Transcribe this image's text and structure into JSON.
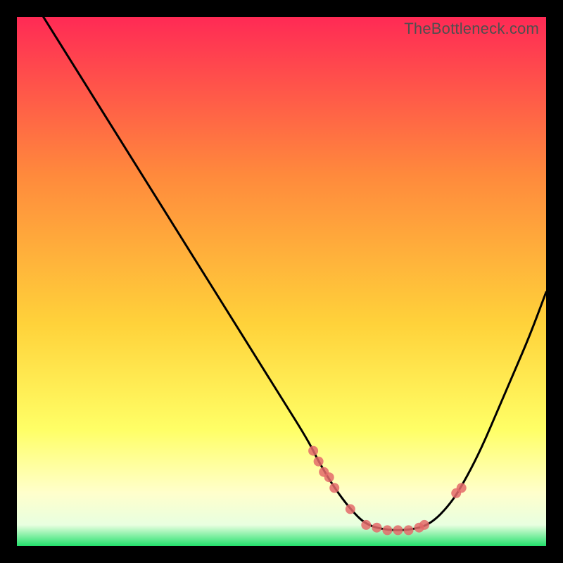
{
  "watermark": "TheBottleneck.com",
  "colors": {
    "gradient_top": "#ff2a55",
    "gradient_mid_upper": "#ff6a3c",
    "gradient_mid": "#ffd23a",
    "gradient_lower": "#ffff66",
    "gradient_pale": "#ffffcc",
    "gradient_bottom": "#22e06b",
    "curve": "#000000",
    "marker": "#e46a6a",
    "background": "#000000"
  },
  "chart_data": {
    "type": "line",
    "title": "",
    "xlabel": "",
    "ylabel": "",
    "xlim": [
      0,
      100
    ],
    "ylim": [
      0,
      100
    ],
    "series": [
      {
        "name": "bottleneck-curve",
        "x": [
          5,
          10,
          15,
          20,
          25,
          30,
          35,
          40,
          45,
          50,
          55,
          57,
          60,
          63,
          66,
          70,
          74,
          78,
          82,
          85,
          88,
          91,
          94,
          97,
          100
        ],
        "y": [
          100,
          92,
          84,
          76,
          68,
          60,
          52,
          44,
          36,
          28,
          20,
          16,
          11,
          7,
          4,
          3,
          3,
          4,
          8,
          13,
          19,
          26,
          33,
          40,
          48
        ]
      }
    ],
    "markers": {
      "name": "highlight-points",
      "x": [
        56,
        57,
        58,
        59,
        60,
        63,
        66,
        68,
        70,
        72,
        74,
        76,
        77,
        83,
        84
      ],
      "y": [
        18,
        16,
        14,
        13,
        11,
        7,
        4,
        3.5,
        3,
        3,
        3,
        3.5,
        4,
        10,
        11
      ]
    }
  }
}
